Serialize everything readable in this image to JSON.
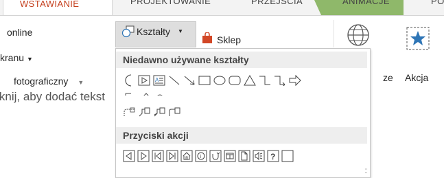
{
  "tabs": [
    {
      "label": "WSTAWIANIE",
      "active": true
    },
    {
      "label": "PROJEKTOWANIE",
      "active": false
    },
    {
      "label": "PRZEJŚCIA",
      "active": false
    },
    {
      "label": "ANIMACJE",
      "active": false
    },
    {
      "label": "POKAZ SLAJDÓW",
      "active": false
    }
  ],
  "ribbon": {
    "left_items": [
      "online",
      "kranu",
      "fotograficzny"
    ],
    "shapes_button": "Kształty",
    "store_button": "Sklep",
    "action_button": "Akcja",
    "partial_right_label": "ze"
  },
  "slide": {
    "text": "Kliknij, aby dodać tekst"
  },
  "gallery": {
    "recent_header": "Niedawno używane kształty",
    "action_header": "Przyciski akcji"
  },
  "colors": {
    "accent": "#c43e1c",
    "tab_green": "#8fb86a",
    "star_blue": "#2e75b6"
  }
}
